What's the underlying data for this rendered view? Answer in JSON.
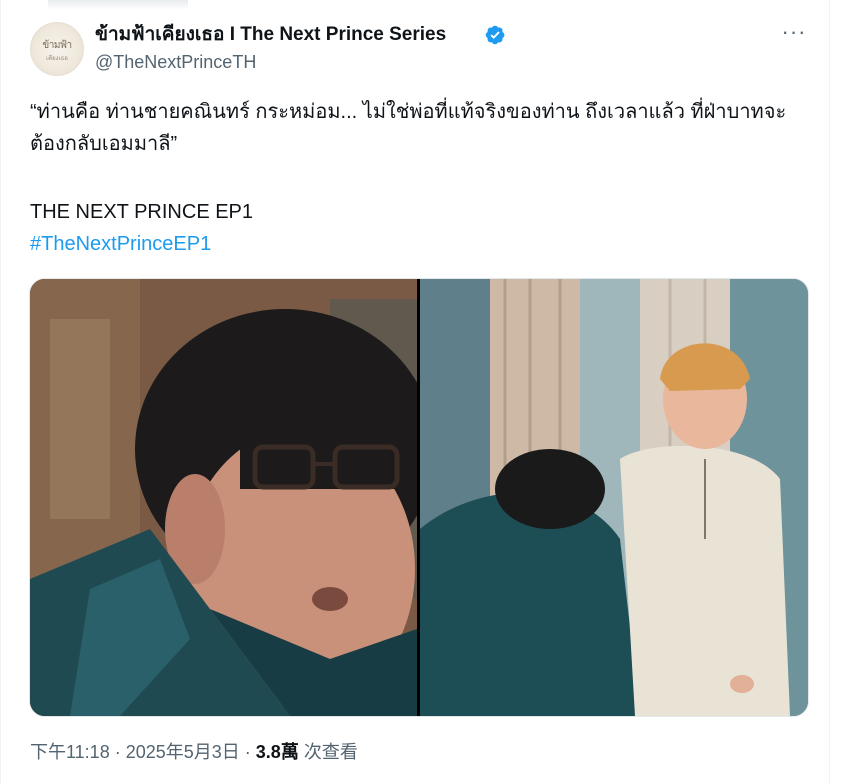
{
  "author": {
    "display_name": "ข้ามฟ้าเคียงเธอ I The Next Prince Series",
    "handle": "@TheNextPrinceTH",
    "avatar_logo_text": "ข้ามฟ้า",
    "avatar_logo_subtext": "เคียงเธอ"
  },
  "tweet": {
    "text": "“ท่านคือ ท่านชายคณินทร์ กระหม่อม... ไม่ใช่พ่อที่แท้จริงของท่าน ถึงเวลาแล้ว ที่ฝ่าบาทจะต้องกลับเอมมาลี”",
    "episode_line": "THE NEXT PRINCE EP1",
    "hashtag": "#TheNextPrinceEP1"
  },
  "meta": {
    "time": "下午11:18",
    "sep": " · ",
    "date": "2025年5月3日",
    "views_count": "3.8萬",
    "views_label": " 次查看"
  },
  "colors": {
    "link": "#1d9bf0",
    "verified": "#1d9bf0",
    "secondary_text": "#536471"
  },
  "icons": {
    "verified": "verified-badge-icon",
    "more": "more-options-icon"
  }
}
